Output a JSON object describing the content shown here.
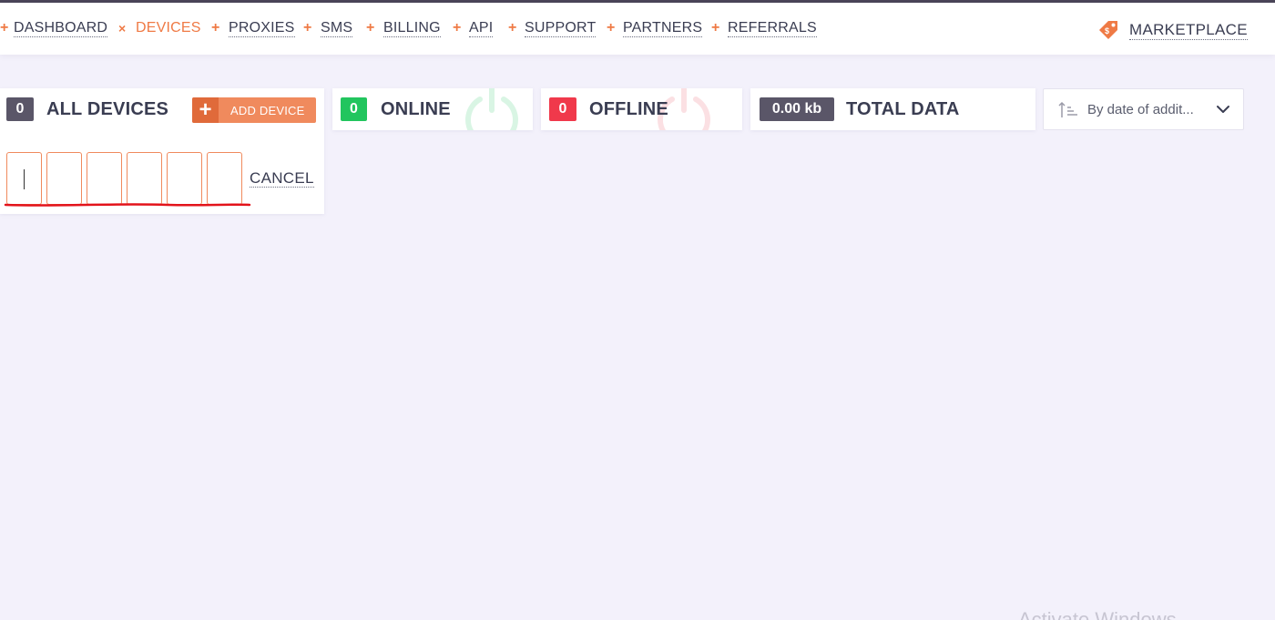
{
  "nav": {
    "items": [
      {
        "label": "DASHBOARD",
        "mark": "+",
        "active": false
      },
      {
        "label": "DEVICES",
        "mark": "×",
        "active": true
      },
      {
        "label": "PROXIES",
        "mark": "+",
        "active": false
      },
      {
        "label": "SMS",
        "mark": "+",
        "active": false
      },
      {
        "label": "BILLING",
        "mark": "+",
        "active": false
      },
      {
        "label": "API",
        "mark": "+",
        "active": false
      },
      {
        "label": "SUPPORT",
        "mark": "+",
        "active": false
      },
      {
        "label": "PARTNERS",
        "mark": "+",
        "active": false
      },
      {
        "label": "REFERRALS",
        "mark": "+",
        "active": false
      }
    ],
    "marketplace": {
      "label": "MARKETPLACE",
      "icon": "price-tag-icon"
    }
  },
  "stats": {
    "all_devices": {
      "count": "0",
      "title": "ALL DEVICES",
      "add_label": "ADD DEVICE"
    },
    "online": {
      "count": "0",
      "title": "ONLINE",
      "icon": "power-icon"
    },
    "offline": {
      "count": "0",
      "title": "OFFLINE",
      "icon": "power-icon"
    },
    "total_data": {
      "value": "0.00 kb",
      "title": "TOTAL DATA"
    }
  },
  "code_entry": {
    "fields": 6,
    "cancel_label": "CANCEL"
  },
  "sort": {
    "value": "By date of addit...",
    "icon": "sort-ascending-icon"
  },
  "watermark": "Activate Windows",
  "colors": {
    "accent": "#ef7a45",
    "online": "#22c55e",
    "offline": "#f0394b",
    "neutral_badge": "#5a5668",
    "text": "#3a3d52",
    "background": "#f3f1fb"
  }
}
